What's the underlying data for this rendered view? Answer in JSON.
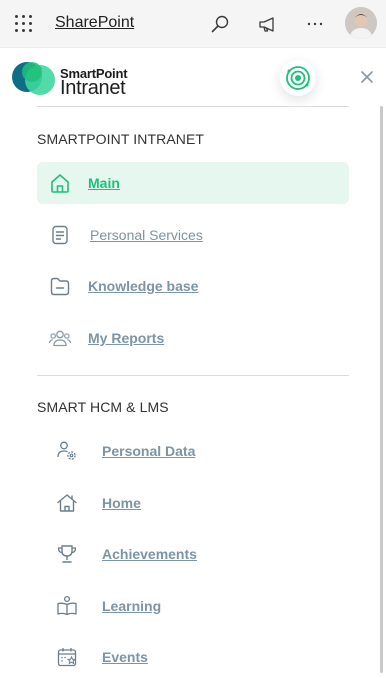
{
  "topbar": {
    "app_name": "SharePoint"
  },
  "panel": {
    "logo": {
      "line1": "SmartPoint",
      "line2": "Intranet"
    },
    "sections": [
      {
        "title": "SMARTPOINT INTRANET",
        "items": [
          {
            "label": "Main",
            "icon": "home-icon",
            "active": true
          },
          {
            "label": "Personal Services",
            "icon": "document-icon"
          },
          {
            "label": "Knowledge base",
            "icon": "folder-icon"
          },
          {
            "label": "My Reports",
            "icon": "people-icon"
          }
        ]
      },
      {
        "title": "SMART HCM & LMS",
        "items": [
          {
            "label": "Personal Data",
            "icon": "person-settings-icon"
          },
          {
            "label": "Home",
            "icon": "house-icon"
          },
          {
            "label": "Achievements",
            "icon": "trophy-icon"
          },
          {
            "label": "Learning",
            "icon": "book-person-icon"
          },
          {
            "label": "Events",
            "icon": "calendar-star-icon"
          }
        ]
      }
    ]
  },
  "colors": {
    "accent": "#1fbf7a",
    "active_bg": "#e6f7ef",
    "link": "#7a95a6",
    "icon": "#6c7e8c"
  }
}
